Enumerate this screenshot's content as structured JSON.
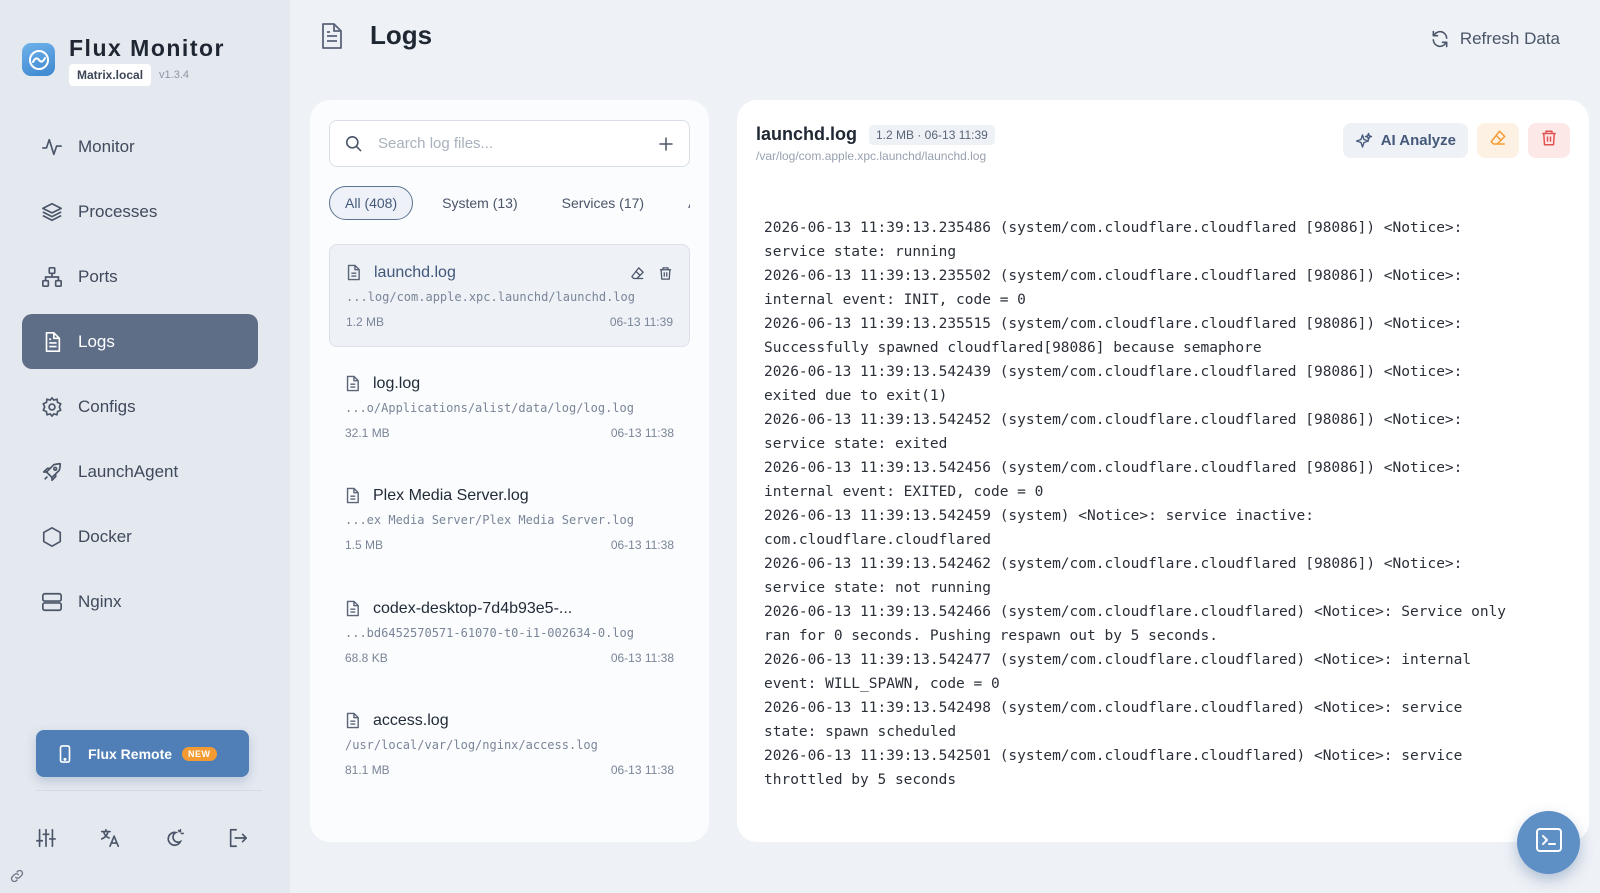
{
  "app": {
    "title": "Flux Monitor",
    "host": "Matrix.local",
    "version": "v1.3.4"
  },
  "nav": {
    "items": [
      {
        "label": "Monitor",
        "icon": "activity-icon"
      },
      {
        "label": "Processes",
        "icon": "layers-icon"
      },
      {
        "label": "Ports",
        "icon": "network-icon"
      },
      {
        "label": "Logs",
        "icon": "file-text-icon",
        "active": true
      },
      {
        "label": "Configs",
        "icon": "gear-icon"
      },
      {
        "label": "LaunchAgent",
        "icon": "rocket-icon"
      },
      {
        "label": "Docker",
        "icon": "hexagon-icon"
      },
      {
        "label": "Nginx",
        "icon": "server-icon"
      }
    ]
  },
  "remote": {
    "label": "Flux Remote",
    "badge": "NEW"
  },
  "header": {
    "title": "Logs",
    "refresh_label": "Refresh Data"
  },
  "search": {
    "placeholder": "Search log files..."
  },
  "filters": [
    {
      "label": "All (408)",
      "active": true
    },
    {
      "label": "System (13)"
    },
    {
      "label": "Services (17)"
    },
    {
      "label": "Ap"
    }
  ],
  "files": [
    {
      "name": "launchd.log",
      "path": "...log/com.apple.xpc.launchd/launchd.log",
      "size": "1.2 MB",
      "time": "06-13 11:39",
      "selected": true
    },
    {
      "name": "log.log",
      "path": "...o/Applications/alist/data/log/log.log",
      "size": "32.1 MB",
      "time": "06-13 11:38"
    },
    {
      "name": "Plex Media Server.log",
      "path": "...ex Media Server/Plex Media Server.log",
      "size": "1.5 MB",
      "time": "06-13 11:38"
    },
    {
      "name": "codex-desktop-7d4b93e5-...",
      "path": "...bd6452570571-61070-t0-i1-002634-0.log",
      "size": "68.8 KB",
      "time": "06-13 11:38"
    },
    {
      "name": "access.log",
      "path": "/usr/local/var/log/nginx/access.log",
      "size": "81.1 MB",
      "time": "06-13 11:38"
    }
  ],
  "viewer": {
    "name": "launchd.log",
    "meta": "1.2 MB · 06-13 11:39",
    "path": "/var/log/com.apple.xpc.launchd/launchd.log",
    "ai_label": "AI Analyze",
    "content": "2026-06-13 11:39:13.235486 (system/com.cloudflare.cloudflared [98086]) <Notice>:\nservice state: running\n2026-06-13 11:39:13.235502 (system/com.cloudflare.cloudflared [98086]) <Notice>:\ninternal event: INIT, code = 0\n2026-06-13 11:39:13.235515 (system/com.cloudflare.cloudflared [98086]) <Notice>:\nSuccessfully spawned cloudflared[98086] because semaphore\n2026-06-13 11:39:13.542439 (system/com.cloudflare.cloudflared [98086]) <Notice>:\nexited due to exit(1)\n2026-06-13 11:39:13.542452 (system/com.cloudflare.cloudflared [98086]) <Notice>:\nservice state: exited\n2026-06-13 11:39:13.542456 (system/com.cloudflare.cloudflared [98086]) <Notice>:\ninternal event: EXITED, code = 0\n2026-06-13 11:39:13.542459 (system) <Notice>: service inactive:\ncom.cloudflare.cloudflared\n2026-06-13 11:39:13.542462 (system/com.cloudflare.cloudflared [98086]) <Notice>:\nservice state: not running\n2026-06-13 11:39:13.542466 (system/com.cloudflare.cloudflared) <Notice>: Service only\nran for 0 seconds. Pushing respawn out by 5 seconds.\n2026-06-13 11:39:13.542477 (system/com.cloudflare.cloudflared) <Notice>: internal\nevent: WILL_SPAWN, code = 0\n2026-06-13 11:39:13.542498 (system/com.cloudflare.cloudflared) <Notice>: service\nstate: spawn scheduled\n2026-06-13 11:39:13.542501 (system/com.cloudflare.cloudflared) <Notice>: service\nthrottled by 5 seconds"
  },
  "colors": {
    "accent": "#5e6e87",
    "primary": "#4f7fb6",
    "warning": "#f39b32",
    "danger": "#e05252"
  }
}
